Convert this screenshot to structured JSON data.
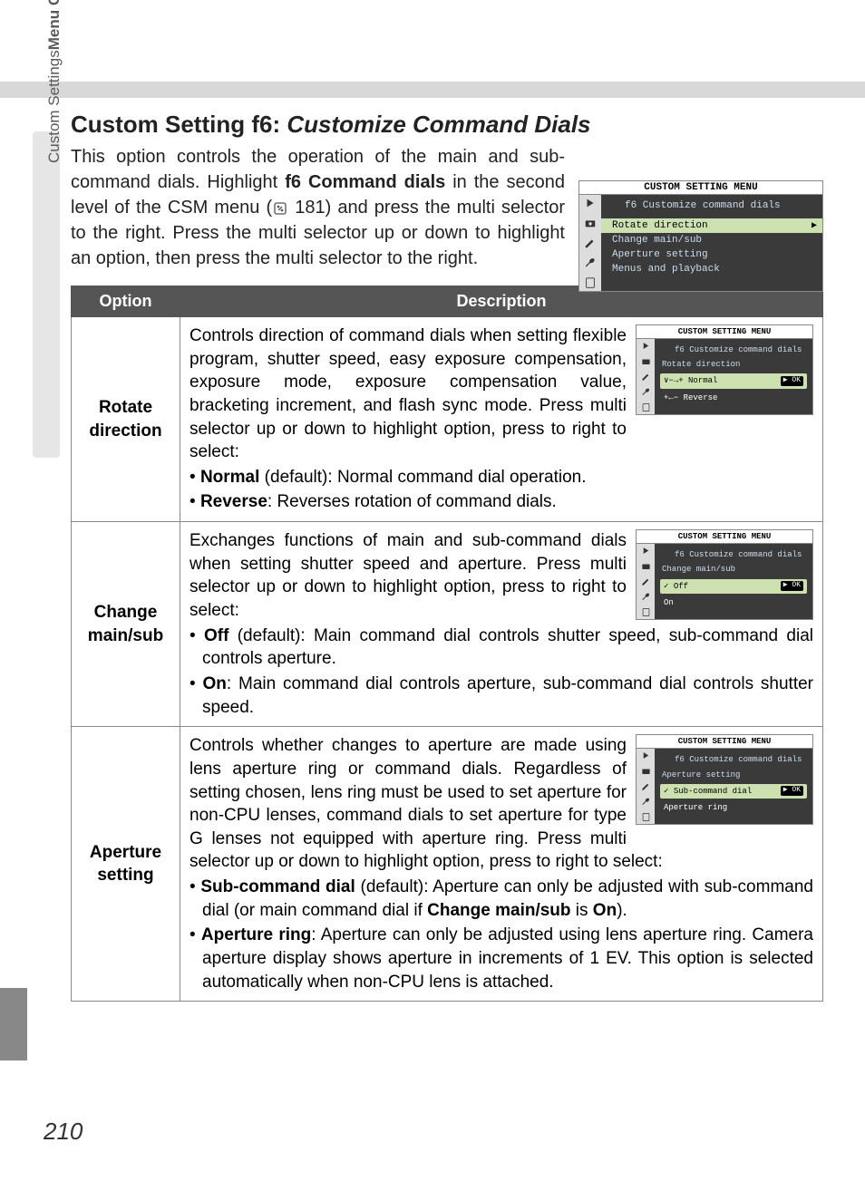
{
  "sideLabel": {
    "bold": "Menu Guide—",
    "light": "Custom Settings"
  },
  "heading": {
    "prefix": "Custom Setting f6: ",
    "italic": "Customize Command Dials"
  },
  "intro": {
    "t1": "This option controls the operation of the main and sub-command dials. Highlight ",
    "b1": "f6 Command dials",
    "t2": " in the second level of the CSM menu (",
    "t3": " 181) and press the multi selector to the right. Press the multi selector up or down to highlight an option, then press the multi selector to the right."
  },
  "mainScreenshot": {
    "title": "CUSTOM SETTING MENU",
    "sub": "f6 Customize command dials",
    "items": [
      {
        "label": "Rotate direction",
        "hl": true,
        "arrow": "▶"
      },
      {
        "label": "Change main/sub"
      },
      {
        "label": "Aperture setting"
      },
      {
        "label": "Menus and playback"
      }
    ]
  },
  "tableHeaders": {
    "option": "Option",
    "description": "Description"
  },
  "rows": [
    {
      "option": "Rotate direction",
      "desc": {
        "t1": "Controls direction of command dials when setting flexible program, shutter speed, easy exposure compensation, exposure mode, exposure compensation value, bracketing increment, and flash sync mode. Press multi selector up or down to highlight option, press to right to select:",
        "bullets": [
          {
            "b": "Normal",
            "t": " (default): Normal command dial operation."
          },
          {
            "b": "Reverse",
            "t": ": Reverses rotation of command dials."
          }
        ]
      },
      "ss": {
        "title": "CUSTOM SETTING MENU",
        "sub": "f6 Customize command dials",
        "section": "Rotate direction",
        "opts": [
          {
            "sym": "∨−→+",
            "label": "Normal",
            "hl": true,
            "ok": "▶ OK"
          },
          {
            "sym": "+←−",
            "label": "Reverse"
          }
        ]
      }
    },
    {
      "option": "Change main/sub",
      "desc": {
        "t1": "Exchanges functions of main and sub-command dials when setting shutter speed and aperture. Press multi selector up or down to highlight option, press to right to select:",
        "bullets": [
          {
            "b": "Off",
            "t": " (default): Main command dial controls shutter speed, sub-command dial controls aperture."
          },
          {
            "b": "On",
            "t": ": Main command dial controls aperture, sub-command dial controls shutter speed."
          }
        ]
      },
      "ss": {
        "title": "CUSTOM SETTING MENU",
        "sub": "f6 Customize command dials",
        "section": "Change main/sub",
        "opts": [
          {
            "sym": "✓",
            "label": "Off",
            "hl": true,
            "ok": "▶ OK"
          },
          {
            "sym": "",
            "label": "On"
          }
        ]
      }
    },
    {
      "option": "Aperture setting",
      "desc": {
        "t1": "Controls whether changes to aperture are made using lens aperture ring or command dials. Regardless of setting chosen, lens ring must be used to set aperture for non-CPU lenses, command dials to set aperture for type G lenses not equipped with aperture ring. Press multi selector up or down to highlight option, press to right to select:",
        "bullets": [
          {
            "b": "Sub-command dial",
            "t": " (default): Aperture can only be adjusted with sub-command dial (or main command dial if ",
            "b2": "Change main/sub",
            "t2": " is ",
            "b3": "On",
            "t3": ")."
          },
          {
            "b": "Aperture ring",
            "t": ": Aperture can only be adjusted using lens aperture ring. Camera aperture display shows aperture in increments of 1 EV. This option is selected automatically when non-CPU lens is attached."
          }
        ]
      },
      "ss": {
        "title": "CUSTOM SETTING MENU",
        "sub": "f6 Customize command dials",
        "section": "Aperture setting",
        "opts": [
          {
            "sym": "✓",
            "label": "Sub-command dial",
            "hl": true,
            "ok": "▶ OK"
          },
          {
            "sym": "",
            "label": "Aperture ring"
          }
        ]
      }
    }
  ],
  "pageNumber": "210"
}
